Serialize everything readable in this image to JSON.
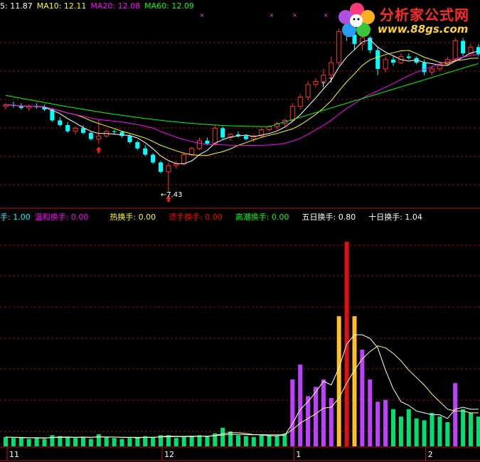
{
  "price_header": [
    {
      "label": "5",
      "value": "11.87",
      "color": "#ffffff"
    },
    {
      "label": "MA10",
      "value": "12.11",
      "color": "#ffff00"
    },
    {
      "label": "MA20",
      "value": "12.08",
      "color": "#ff00ff"
    },
    {
      "label": "MA60",
      "value": "12.09",
      "color": "#00ff00"
    }
  ],
  "indicator_header": [
    {
      "label": "手",
      "value": "1.00",
      "color": "#00ffff"
    },
    {
      "label": "温和换手",
      "value": "0.00",
      "color": "#ff00ff"
    },
    {
      "label": "热换手",
      "value": "0.00",
      "color": "#ffff00"
    },
    {
      "label": "烫手换手",
      "value": "0.00",
      "color": "#ff0000"
    },
    {
      "label": "高潮换手",
      "value": "0.00",
      "color": "#00ff00"
    },
    {
      "label": "五日换手",
      "value": "0.80",
      "color": "#ffffff"
    },
    {
      "label": "十日换手",
      "value": "1.04",
      "color": "#ffffff"
    }
  ],
  "low_marker": "←7.43",
  "watermark": {
    "name": "分析家公式网",
    "url": "www.88gs.com"
  },
  "colors": {
    "up": "#ff3030",
    "down": "#00ffff",
    "ma5": "#ffffff",
    "ma10": "#ffff00",
    "ma20": "#ff00ff",
    "ma60": "#00ff00",
    "grid": "#8a1010",
    "axis": "#b01818"
  },
  "chart_data": [
    {
      "type": "candlestick",
      "ylim": [
        7.0,
        13.2
      ],
      "x_tick_labels": [
        {
          "label": "11",
          "index": 0
        },
        {
          "label": "12",
          "index": 20
        },
        {
          "label": "1",
          "index": 37
        },
        {
          "label": "2",
          "index": 54
        }
      ],
      "candles": [
        [
          10.2,
          10.3,
          10.1,
          10.25
        ],
        [
          10.25,
          10.35,
          10.15,
          10.22
        ],
        [
          10.22,
          10.3,
          10.1,
          10.15
        ],
        [
          10.15,
          10.25,
          10.05,
          10.2
        ],
        [
          10.2,
          10.3,
          10.12,
          10.18
        ],
        [
          10.18,
          10.25,
          10.05,
          10.1
        ],
        [
          10.1,
          10.15,
          9.7,
          9.75
        ],
        [
          9.75,
          9.85,
          9.55,
          9.6
        ],
        [
          9.6,
          9.7,
          9.35,
          9.4
        ],
        [
          9.4,
          9.55,
          9.3,
          9.5
        ],
        [
          9.5,
          9.6,
          9.3,
          9.35
        ],
        [
          9.35,
          9.4,
          9.1,
          9.15
        ],
        [
          9.15,
          9.8,
          9.0,
          9.25
        ],
        [
          9.25,
          9.45,
          9.2,
          9.4
        ],
        [
          9.4,
          9.45,
          9.3,
          9.38
        ],
        [
          9.38,
          9.4,
          9.2,
          9.25
        ],
        [
          9.25,
          9.3,
          9.0,
          9.05
        ],
        [
          9.05,
          9.1,
          8.8,
          8.85
        ],
        [
          8.85,
          8.95,
          8.6,
          8.65
        ],
        [
          8.65,
          8.7,
          8.35,
          8.4
        ],
        [
          8.4,
          8.45,
          8.05,
          8.1
        ],
        [
          8.1,
          8.4,
          7.43,
          8.3
        ],
        [
          8.3,
          8.45,
          8.2,
          8.35
        ],
        [
          8.35,
          8.7,
          8.3,
          8.65
        ],
        [
          8.65,
          8.9,
          8.6,
          8.85
        ],
        [
          8.85,
          9.2,
          8.8,
          9.1
        ],
        [
          9.1,
          9.2,
          8.95,
          9.0
        ],
        [
          9.0,
          9.6,
          8.95,
          9.5
        ],
        [
          9.5,
          9.55,
          9.15,
          9.2
        ],
        [
          9.2,
          9.35,
          9.1,
          9.3
        ],
        [
          9.3,
          9.4,
          9.2,
          9.25
        ],
        [
          9.25,
          9.3,
          9.1,
          9.15
        ],
        [
          9.15,
          9.3,
          9.05,
          9.25
        ],
        [
          9.25,
          9.5,
          9.2,
          9.45
        ],
        [
          9.45,
          9.6,
          9.4,
          9.55
        ],
        [
          9.55,
          9.7,
          9.45,
          9.65
        ],
        [
          9.65,
          9.8,
          9.55,
          9.75
        ],
        [
          9.75,
          10.3,
          9.7,
          10.2
        ],
        [
          10.2,
          10.6,
          10.1,
          10.5
        ],
        [
          10.5,
          11.0,
          10.4,
          10.9
        ],
        [
          10.9,
          11.1,
          10.8,
          11.0
        ],
        [
          11.0,
          11.4,
          10.95,
          11.2
        ],
        [
          11.2,
          11.8,
          11.1,
          11.6
        ],
        [
          11.6,
          12.7,
          11.5,
          12.6
        ],
        [
          12.6,
          13.0,
          12.3,
          12.5
        ],
        [
          12.5,
          12.7,
          12.0,
          12.2
        ],
        [
          12.2,
          12.5,
          12.0,
          12.4
        ],
        [
          12.4,
          12.45,
          11.9,
          12.0
        ],
        [
          12.0,
          12.1,
          11.2,
          11.4
        ],
        [
          11.4,
          11.8,
          11.3,
          11.7
        ],
        [
          11.7,
          11.8,
          11.5,
          11.6
        ],
        [
          11.6,
          11.9,
          11.55,
          11.8
        ],
        [
          11.8,
          11.9,
          11.7,
          11.75
        ],
        [
          11.75,
          11.8,
          11.55,
          11.6
        ],
        [
          11.6,
          11.7,
          11.2,
          11.3
        ],
        [
          11.3,
          11.5,
          11.2,
          11.4
        ],
        [
          11.4,
          11.6,
          11.35,
          11.55
        ],
        [
          11.55,
          11.8,
          11.5,
          11.7
        ],
        [
          11.7,
          12.4,
          11.65,
          12.3
        ],
        [
          12.3,
          12.4,
          11.8,
          11.9
        ],
        [
          11.9,
          12.2,
          11.85,
          12.1
        ],
        [
          12.1,
          12.2,
          11.8,
          11.87
        ]
      ],
      "ma5_label": "5",
      "ma10_label": "MA10",
      "ma20_label": "MA20",
      "ma60_label": "MA60"
    },
    {
      "type": "bar",
      "ylim": [
        0,
        12
      ],
      "values": [
        0.5,
        0.45,
        0.5,
        0.4,
        0.45,
        0.4,
        0.6,
        0.55,
        0.5,
        0.45,
        0.5,
        0.4,
        0.65,
        0.5,
        0.45,
        0.4,
        0.45,
        0.5,
        0.55,
        0.5,
        0.6,
        0.6,
        0.45,
        0.5,
        0.55,
        0.6,
        0.55,
        0.7,
        1.0,
        0.8,
        0.6,
        0.55,
        0.5,
        0.65,
        0.6,
        0.55,
        0.7,
        3.6,
        4.4,
        2.7,
        3.2,
        3.6,
        2.6,
        7.0,
        11.0,
        7.0,
        5.2,
        3.6,
        2.4,
        2.5,
        2.0,
        1.6,
        2.0,
        1.5,
        1.4,
        1.8,
        1.6,
        1.3,
        3.4,
        2.0,
        1.8,
        1.6
      ],
      "color_classes": [
        "g",
        "g",
        "g",
        "g",
        "g",
        "g",
        "g",
        "g",
        "g",
        "g",
        "g",
        "g",
        "g",
        "g",
        "g",
        "g",
        "g",
        "g",
        "g",
        "g",
        "g",
        "g",
        "g",
        "g",
        "g",
        "g",
        "g",
        "g",
        "g",
        "g",
        "g",
        "g",
        "g",
        "g",
        "g",
        "g",
        "g",
        "m",
        "m",
        "m",
        "m",
        "m",
        "m",
        "y",
        "r",
        "y",
        "m",
        "m",
        "m",
        "m",
        "g",
        "g",
        "g",
        "g",
        "g",
        "g",
        "g",
        "g",
        "m",
        "g",
        "g",
        "g"
      ],
      "ma5": [
        0.5,
        0.48,
        0.47,
        0.46,
        0.46,
        0.44,
        0.48,
        0.5,
        0.5,
        0.49,
        0.5,
        0.48,
        0.52,
        0.5,
        0.5,
        0.48,
        0.48,
        0.46,
        0.48,
        0.48,
        0.52,
        0.55,
        0.54,
        0.54,
        0.55,
        0.55,
        0.54,
        0.59,
        0.68,
        0.73,
        0.73,
        0.69,
        0.63,
        0.62,
        0.57,
        0.57,
        0.6,
        1.22,
        1.98,
        2.4,
        2.92,
        3.5,
        3.3,
        4.22,
        5.5,
        6.0,
        6.0,
        5.8,
        5.3,
        4.1,
        3.1,
        2.4,
        2.2,
        1.9,
        1.8,
        1.7,
        1.7,
        1.5,
        2.0,
        2.1,
        2.0,
        2.0
      ],
      "ma10": [
        0.5,
        0.49,
        0.48,
        0.47,
        0.47,
        0.46,
        0.47,
        0.48,
        0.48,
        0.48,
        0.49,
        0.49,
        0.5,
        0.5,
        0.5,
        0.49,
        0.49,
        0.48,
        0.49,
        0.49,
        0.5,
        0.52,
        0.52,
        0.52,
        0.53,
        0.54,
        0.55,
        0.57,
        0.61,
        0.64,
        0.64,
        0.63,
        0.62,
        0.63,
        0.62,
        0.62,
        0.62,
        0.9,
        1.25,
        1.5,
        1.75,
        2.05,
        2.1,
        2.6,
        3.4,
        4.1,
        4.7,
        5.1,
        5.4,
        5.3,
        5.0,
        4.6,
        4.1,
        3.7,
        3.3,
        2.8,
        2.4,
        2.0,
        1.9,
        1.9,
        1.8,
        1.8
      ]
    }
  ]
}
